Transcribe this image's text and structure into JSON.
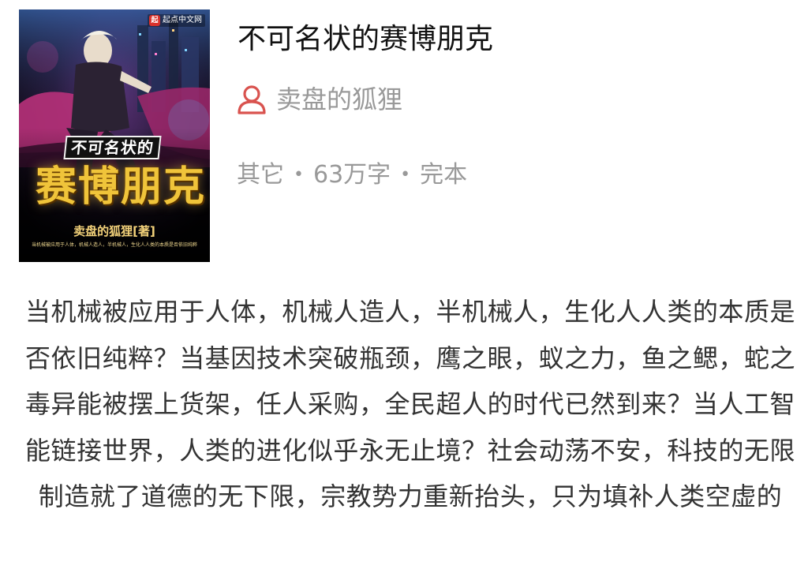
{
  "book": {
    "title": "不可名状的赛博朋克",
    "author": "卖盘的狐狸",
    "category": "其它",
    "word_count": "63万字",
    "status": "完本",
    "separator": "•",
    "description": "当机械被应用于人体，机械人造人，半机械人，生化人人类的本质是否依旧纯粹？当基因技术突破瓶颈，鹰之眼，蚁之力，鱼之鳃，蛇之毒异能被摆上货架，任人采购，全民超人的时代已然到来？当人工智能链接世界，人类的进化似乎永无止境？社会动荡不安，科技的无限制造就了道德的无下限，宗教势力重新抬头，只为填补人类空虚的"
  },
  "cover": {
    "publisher_logo": "起",
    "publisher_name": "起点中文网",
    "small_title": "不可名状的",
    "big_title": "赛博朋克",
    "author_credit": "卖盘的狐狸[著]",
    "tagline": "当机械被应用于人体，机械人造人，半机械人，生化人人类的本质是否依旧纯粹"
  },
  "colors": {
    "title": "#111111",
    "secondary_text": "#999999",
    "body_text": "#333333",
    "author_icon": "#d9534f",
    "cover_gold": "#f0c43a",
    "publisher_red": "#d9312b"
  },
  "icons": {
    "author": "person-outline-icon"
  }
}
